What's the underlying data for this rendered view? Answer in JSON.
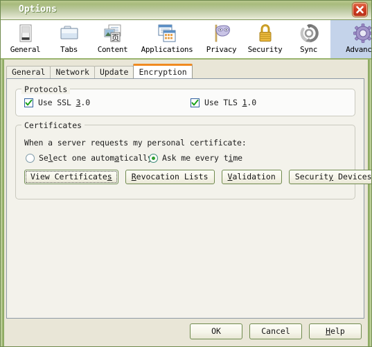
{
  "window": {
    "title": "Options",
    "close_icon": "close-x-icon",
    "frame_color": "#9ab46e",
    "titlebar_color": "#a8bb7c",
    "body_color": "#e9e6d7"
  },
  "toolbar": {
    "items": [
      {
        "label": "General",
        "icon": "general-window-icon",
        "selected": false
      },
      {
        "label": "Tabs",
        "icon": "tabs-folder-icon",
        "selected": false
      },
      {
        "label": "Content",
        "icon": "content-page-icon",
        "selected": false
      },
      {
        "label": "Applications",
        "icon": "applications-windows-icon",
        "selected": false
      },
      {
        "label": "Privacy",
        "icon": "privacy-mask-icon",
        "selected": false
      },
      {
        "label": "Security",
        "icon": "security-padlock-icon",
        "selected": false
      },
      {
        "label": "Sync",
        "icon": "sync-arrows-icon",
        "selected": false
      },
      {
        "label": "Advanced",
        "icon": "advanced-gear-icon",
        "selected": true
      }
    ],
    "selected_highlight": "#c4d3ea"
  },
  "tabs": {
    "items": [
      {
        "label": "General",
        "active": false
      },
      {
        "label": "Network",
        "active": false
      },
      {
        "label": "Update",
        "active": false
      },
      {
        "label": "Encryption",
        "active": true
      }
    ],
    "active_indicator_color": "#f08a20"
  },
  "protocols": {
    "legend": "Protocols",
    "options": [
      {
        "pre": "Use SSL ",
        "accel": "3",
        "post": ".0",
        "checked": true,
        "name": "use-ssl-3-checkbox"
      },
      {
        "pre": "Use TLS ",
        "accel": "1",
        "post": ".0",
        "checked": true,
        "name": "use-tls-1-checkbox"
      }
    ]
  },
  "certificates": {
    "legend": "Certificates",
    "question": "When a server requests my personal certificate:",
    "radios": [
      {
        "p1": "Se",
        "accel1": "l",
        "p2": "ect one autom",
        "accel2": "a",
        "p3": "tically",
        "selected": false,
        "name": "select-one-automatically-radio"
      },
      {
        "p1": "Ask me every t",
        "accel1": "i",
        "p2": "me",
        "accel2": "",
        "p3": "",
        "selected": true,
        "name": "ask-me-every-time-radio"
      }
    ],
    "buttons": [
      {
        "pre": "View Certificate",
        "accel": "s",
        "post": "",
        "focused": true,
        "name": "view-certificates-button"
      },
      {
        "pre": "",
        "accel": "R",
        "post": "evocation Lists",
        "focused": false,
        "name": "revocation-lists-button"
      },
      {
        "pre": "",
        "accel": "V",
        "post": "alidation",
        "focused": false,
        "name": "validation-button"
      },
      {
        "pre": "Securit",
        "accel": "y",
        "post": " Devices",
        "focused": false,
        "name": "security-devices-button"
      }
    ]
  },
  "dialog_buttons": [
    {
      "pre": "OK",
      "accel": "",
      "post": "",
      "name": "ok-button"
    },
    {
      "pre": "Cancel",
      "accel": "",
      "post": "",
      "name": "cancel-button"
    },
    {
      "pre": "",
      "accel": "H",
      "post": "elp",
      "name": "help-button"
    }
  ]
}
